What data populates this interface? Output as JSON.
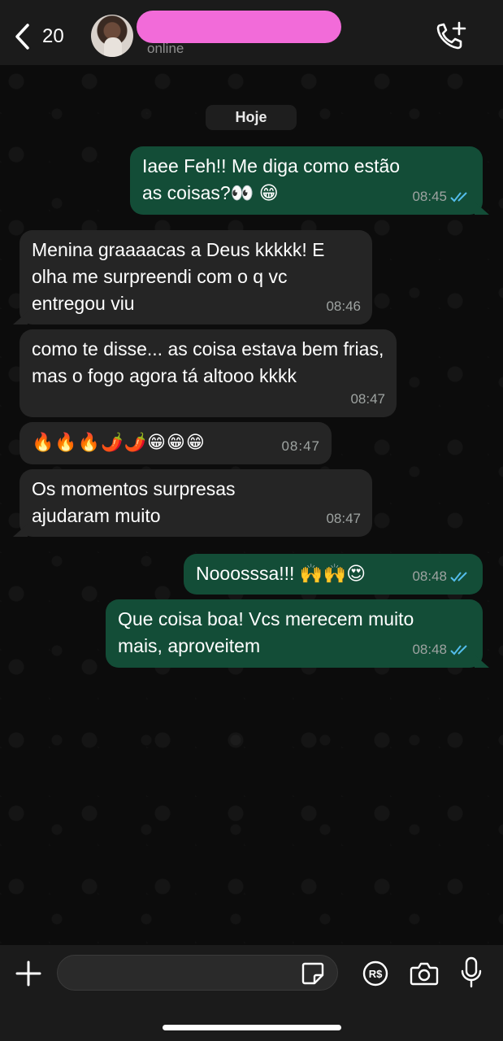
{
  "header": {
    "back_count": "20",
    "status": "online"
  },
  "chat": {
    "date_label": "Hoje",
    "messages": [
      {
        "direction": "outgoing",
        "text": "Iaee Feh!! Me diga como estão as coisas?👀 😁",
        "time": "08:45",
        "read": true
      },
      {
        "direction": "incoming",
        "text": "Menina graaaacas a Deus kkkkk! E olha me surpreendi com o q vc entregou viu",
        "time": "08:46"
      },
      {
        "direction": "incoming",
        "text": "como te disse... as coisa estava bem frias, mas o fogo agora tá altooo kkkk",
        "time": "08:47"
      },
      {
        "direction": "incoming",
        "text": "🔥🔥🔥🌶️🌶️😁😁😁",
        "time": "08:47"
      },
      {
        "direction": "incoming",
        "text": "Os momentos surpresas ajudaram muito",
        "time": "08:47"
      },
      {
        "direction": "outgoing",
        "text": "Nooosssa!!! 🙌🙌😍",
        "time": "08:48",
        "read": true
      },
      {
        "direction": "outgoing",
        "text": "Que coisa boa! Vcs merecem muito mais, aproveitem",
        "time": "08:48",
        "read": true
      }
    ]
  },
  "composer": {
    "value": ""
  },
  "colors": {
    "outgoing_bubble": "#134d37",
    "incoming_bubble": "#252525",
    "read_ticks": "#53bdeb",
    "name_redaction": "#f26bd9"
  },
  "icons": [
    "back-chevron-icon",
    "call-add-icon",
    "plus-icon",
    "sticker-icon",
    "payment-icon",
    "camera-icon",
    "microphone-icon",
    "double-check-icon"
  ]
}
